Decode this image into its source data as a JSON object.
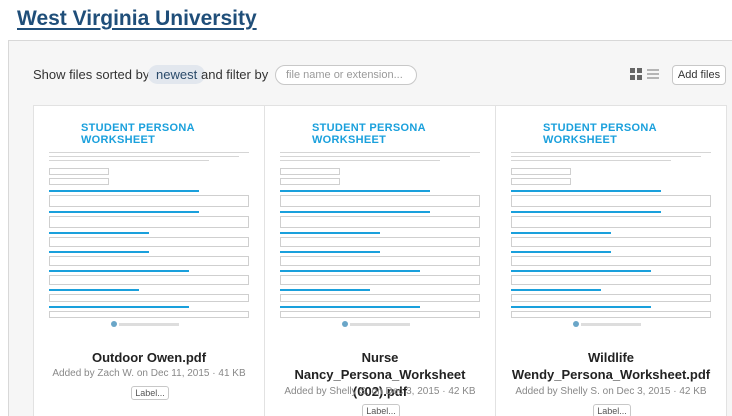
{
  "header": {
    "org_title": "West Virginia University"
  },
  "toolbar": {
    "sort_prefix": "Show files sorted by",
    "sort_value": "newest",
    "filter_label": "and filter by",
    "filter_placeholder": "file name or extension...",
    "add_button": "Add files"
  },
  "files": [
    {
      "thumb_title": "STUDENT PERSONA WORKSHEET",
      "name": "Outdoor Owen.pdf",
      "meta": "Added by Zach W. on Dec 11, 2015 · 41 KB",
      "label_button": "Label..."
    },
    {
      "thumb_title": "STUDENT PERSONA WORKSHEET",
      "name": "Nurse Nancy_Persona_Worksheet (002).pdf",
      "meta": "Added by Shelly S. on Dec 3, 2015 · 42 KB",
      "label_button": "Label..."
    },
    {
      "thumb_title": "STUDENT PERSONA WORKSHEET",
      "name": "Wildlife Wendy_Persona_Worksheet.pdf",
      "meta": "Added by Shelly S. on Dec 3, 2015 · 42 KB",
      "label_button": "Label..."
    }
  ],
  "colors": {
    "brand": "#1f4e79",
    "worksheet_title": "#1aa0dc",
    "pill_bg": "#e2e7ee"
  },
  "icons": {
    "grid_view": "grid-view-icon",
    "list_view": "list-view-icon"
  }
}
